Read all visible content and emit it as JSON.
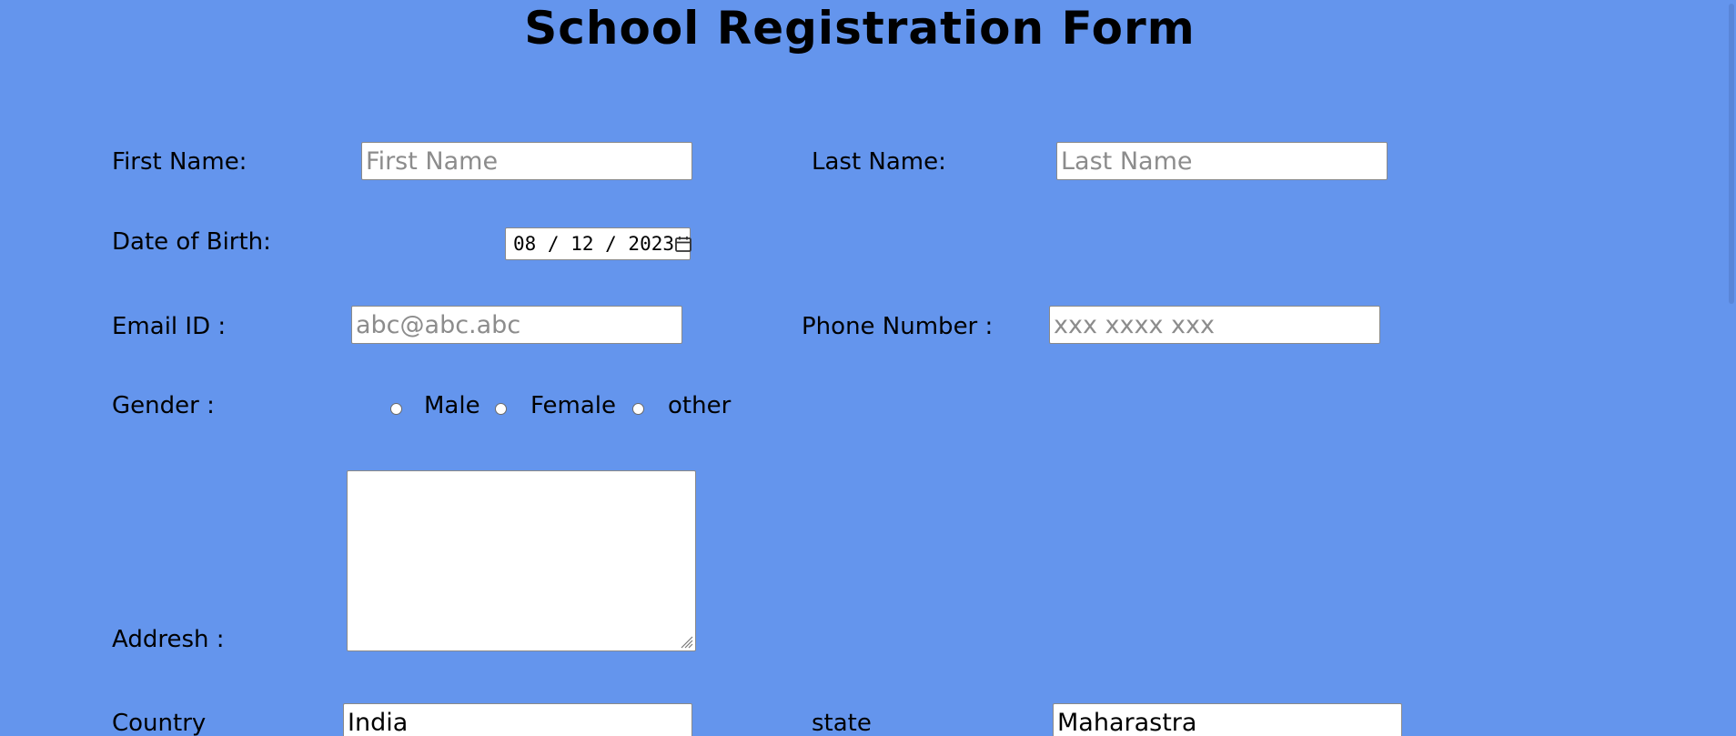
{
  "title": "School Registration Form",
  "fields": {
    "first_name": {
      "label": "First Name:",
      "placeholder": "First Name",
      "value": ""
    },
    "last_name": {
      "label": "Last Name:",
      "placeholder": "Last Name",
      "value": ""
    },
    "dob": {
      "label": "Date of Birth:",
      "value": "08 / 12 / 2023"
    },
    "email": {
      "label": "Email ID :",
      "placeholder": "abc@abc.abc",
      "value": ""
    },
    "phone": {
      "label": "Phone Number :",
      "placeholder": "xxx xxxx xxx",
      "value": ""
    },
    "gender": {
      "label": "Gender :",
      "options": [
        "Male",
        "Female",
        "other"
      ]
    },
    "address": {
      "label": "Addresh :"
    },
    "country": {
      "label": "Country",
      "value": "India"
    },
    "state": {
      "label": "state",
      "value": "Maharastra"
    }
  },
  "icons": {
    "calendar": "calendar-icon",
    "resize": "resize-grip-icon"
  }
}
